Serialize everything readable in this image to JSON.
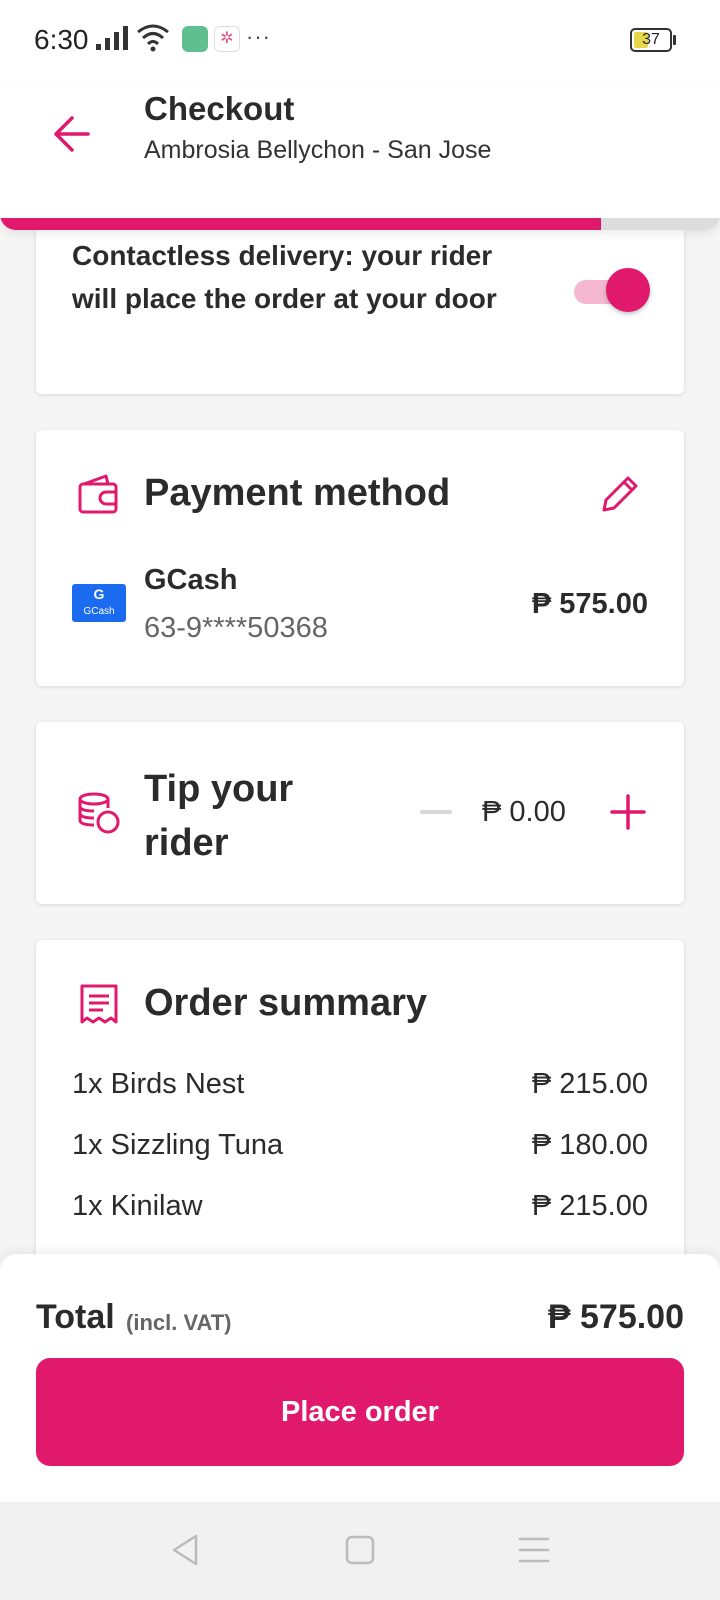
{
  "status_bar": {
    "time": "6:30",
    "more": "···",
    "battery": "37"
  },
  "header": {
    "title": "Checkout",
    "subtitle": "Ambrosia Bellychon - San Jose",
    "progress": 0.835
  },
  "contactless": {
    "text": "Contactless delivery: your rider will place the order at your door",
    "enabled": true
  },
  "payment": {
    "title": "Payment method",
    "method": "GCash",
    "logo_text": "G",
    "logo_label": "GCash",
    "account": "63-9****50368",
    "amount": "₱ 575.00"
  },
  "tip": {
    "title": "Tip your rider",
    "amount": "₱ 0.00"
  },
  "summary": {
    "title": "Order summary",
    "items": [
      {
        "name": "1x Birds Nest",
        "price": "₱ 215.00"
      },
      {
        "name": "1x Sizzling Tuna",
        "price": "₱ 180.00"
      },
      {
        "name": "1x Kinilaw",
        "price": "₱ 215.00"
      }
    ]
  },
  "footer": {
    "total_label": "Total",
    "vat_label": "(incl. VAT)",
    "total_amount": "₱ 575.00",
    "place_order": "Place order"
  },
  "colors": {
    "accent": "#e0196d",
    "gcash": "#1a6bef"
  }
}
